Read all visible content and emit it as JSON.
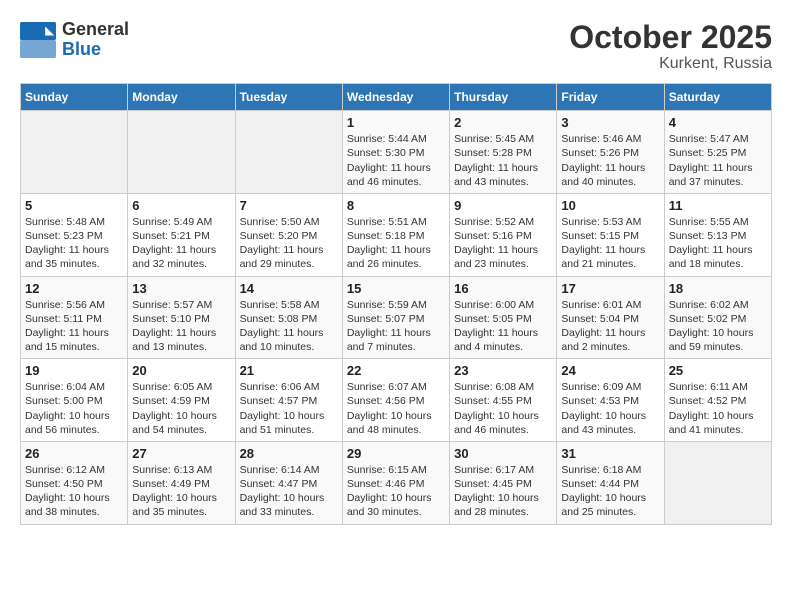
{
  "header": {
    "logo_general": "General",
    "logo_blue": "Blue",
    "title": "October 2025",
    "subtitle": "Kurkent, Russia"
  },
  "weekdays": [
    "Sunday",
    "Monday",
    "Tuesday",
    "Wednesday",
    "Thursday",
    "Friday",
    "Saturday"
  ],
  "weeks": [
    [
      {
        "day": "",
        "info": ""
      },
      {
        "day": "",
        "info": ""
      },
      {
        "day": "",
        "info": ""
      },
      {
        "day": "1",
        "info": "Sunrise: 5:44 AM\nSunset: 5:30 PM\nDaylight: 11 hours\nand 46 minutes."
      },
      {
        "day": "2",
        "info": "Sunrise: 5:45 AM\nSunset: 5:28 PM\nDaylight: 11 hours\nand 43 minutes."
      },
      {
        "day": "3",
        "info": "Sunrise: 5:46 AM\nSunset: 5:26 PM\nDaylight: 11 hours\nand 40 minutes."
      },
      {
        "day": "4",
        "info": "Sunrise: 5:47 AM\nSunset: 5:25 PM\nDaylight: 11 hours\nand 37 minutes."
      }
    ],
    [
      {
        "day": "5",
        "info": "Sunrise: 5:48 AM\nSunset: 5:23 PM\nDaylight: 11 hours\nand 35 minutes."
      },
      {
        "day": "6",
        "info": "Sunrise: 5:49 AM\nSunset: 5:21 PM\nDaylight: 11 hours\nand 32 minutes."
      },
      {
        "day": "7",
        "info": "Sunrise: 5:50 AM\nSunset: 5:20 PM\nDaylight: 11 hours\nand 29 minutes."
      },
      {
        "day": "8",
        "info": "Sunrise: 5:51 AM\nSunset: 5:18 PM\nDaylight: 11 hours\nand 26 minutes."
      },
      {
        "day": "9",
        "info": "Sunrise: 5:52 AM\nSunset: 5:16 PM\nDaylight: 11 hours\nand 23 minutes."
      },
      {
        "day": "10",
        "info": "Sunrise: 5:53 AM\nSunset: 5:15 PM\nDaylight: 11 hours\nand 21 minutes."
      },
      {
        "day": "11",
        "info": "Sunrise: 5:55 AM\nSunset: 5:13 PM\nDaylight: 11 hours\nand 18 minutes."
      }
    ],
    [
      {
        "day": "12",
        "info": "Sunrise: 5:56 AM\nSunset: 5:11 PM\nDaylight: 11 hours\nand 15 minutes."
      },
      {
        "day": "13",
        "info": "Sunrise: 5:57 AM\nSunset: 5:10 PM\nDaylight: 11 hours\nand 13 minutes."
      },
      {
        "day": "14",
        "info": "Sunrise: 5:58 AM\nSunset: 5:08 PM\nDaylight: 11 hours\nand 10 minutes."
      },
      {
        "day": "15",
        "info": "Sunrise: 5:59 AM\nSunset: 5:07 PM\nDaylight: 11 hours\nand 7 minutes."
      },
      {
        "day": "16",
        "info": "Sunrise: 6:00 AM\nSunset: 5:05 PM\nDaylight: 11 hours\nand 4 minutes."
      },
      {
        "day": "17",
        "info": "Sunrise: 6:01 AM\nSunset: 5:04 PM\nDaylight: 11 hours\nand 2 minutes."
      },
      {
        "day": "18",
        "info": "Sunrise: 6:02 AM\nSunset: 5:02 PM\nDaylight: 10 hours\nand 59 minutes."
      }
    ],
    [
      {
        "day": "19",
        "info": "Sunrise: 6:04 AM\nSunset: 5:00 PM\nDaylight: 10 hours\nand 56 minutes."
      },
      {
        "day": "20",
        "info": "Sunrise: 6:05 AM\nSunset: 4:59 PM\nDaylight: 10 hours\nand 54 minutes."
      },
      {
        "day": "21",
        "info": "Sunrise: 6:06 AM\nSunset: 4:57 PM\nDaylight: 10 hours\nand 51 minutes."
      },
      {
        "day": "22",
        "info": "Sunrise: 6:07 AM\nSunset: 4:56 PM\nDaylight: 10 hours\nand 48 minutes."
      },
      {
        "day": "23",
        "info": "Sunrise: 6:08 AM\nSunset: 4:55 PM\nDaylight: 10 hours\nand 46 minutes."
      },
      {
        "day": "24",
        "info": "Sunrise: 6:09 AM\nSunset: 4:53 PM\nDaylight: 10 hours\nand 43 minutes."
      },
      {
        "day": "25",
        "info": "Sunrise: 6:11 AM\nSunset: 4:52 PM\nDaylight: 10 hours\nand 41 minutes."
      }
    ],
    [
      {
        "day": "26",
        "info": "Sunrise: 6:12 AM\nSunset: 4:50 PM\nDaylight: 10 hours\nand 38 minutes."
      },
      {
        "day": "27",
        "info": "Sunrise: 6:13 AM\nSunset: 4:49 PM\nDaylight: 10 hours\nand 35 minutes."
      },
      {
        "day": "28",
        "info": "Sunrise: 6:14 AM\nSunset: 4:47 PM\nDaylight: 10 hours\nand 33 minutes."
      },
      {
        "day": "29",
        "info": "Sunrise: 6:15 AM\nSunset: 4:46 PM\nDaylight: 10 hours\nand 30 minutes."
      },
      {
        "day": "30",
        "info": "Sunrise: 6:17 AM\nSunset: 4:45 PM\nDaylight: 10 hours\nand 28 minutes."
      },
      {
        "day": "31",
        "info": "Sunrise: 6:18 AM\nSunset: 4:44 PM\nDaylight: 10 hours\nand 25 minutes."
      },
      {
        "day": "",
        "info": ""
      }
    ]
  ]
}
